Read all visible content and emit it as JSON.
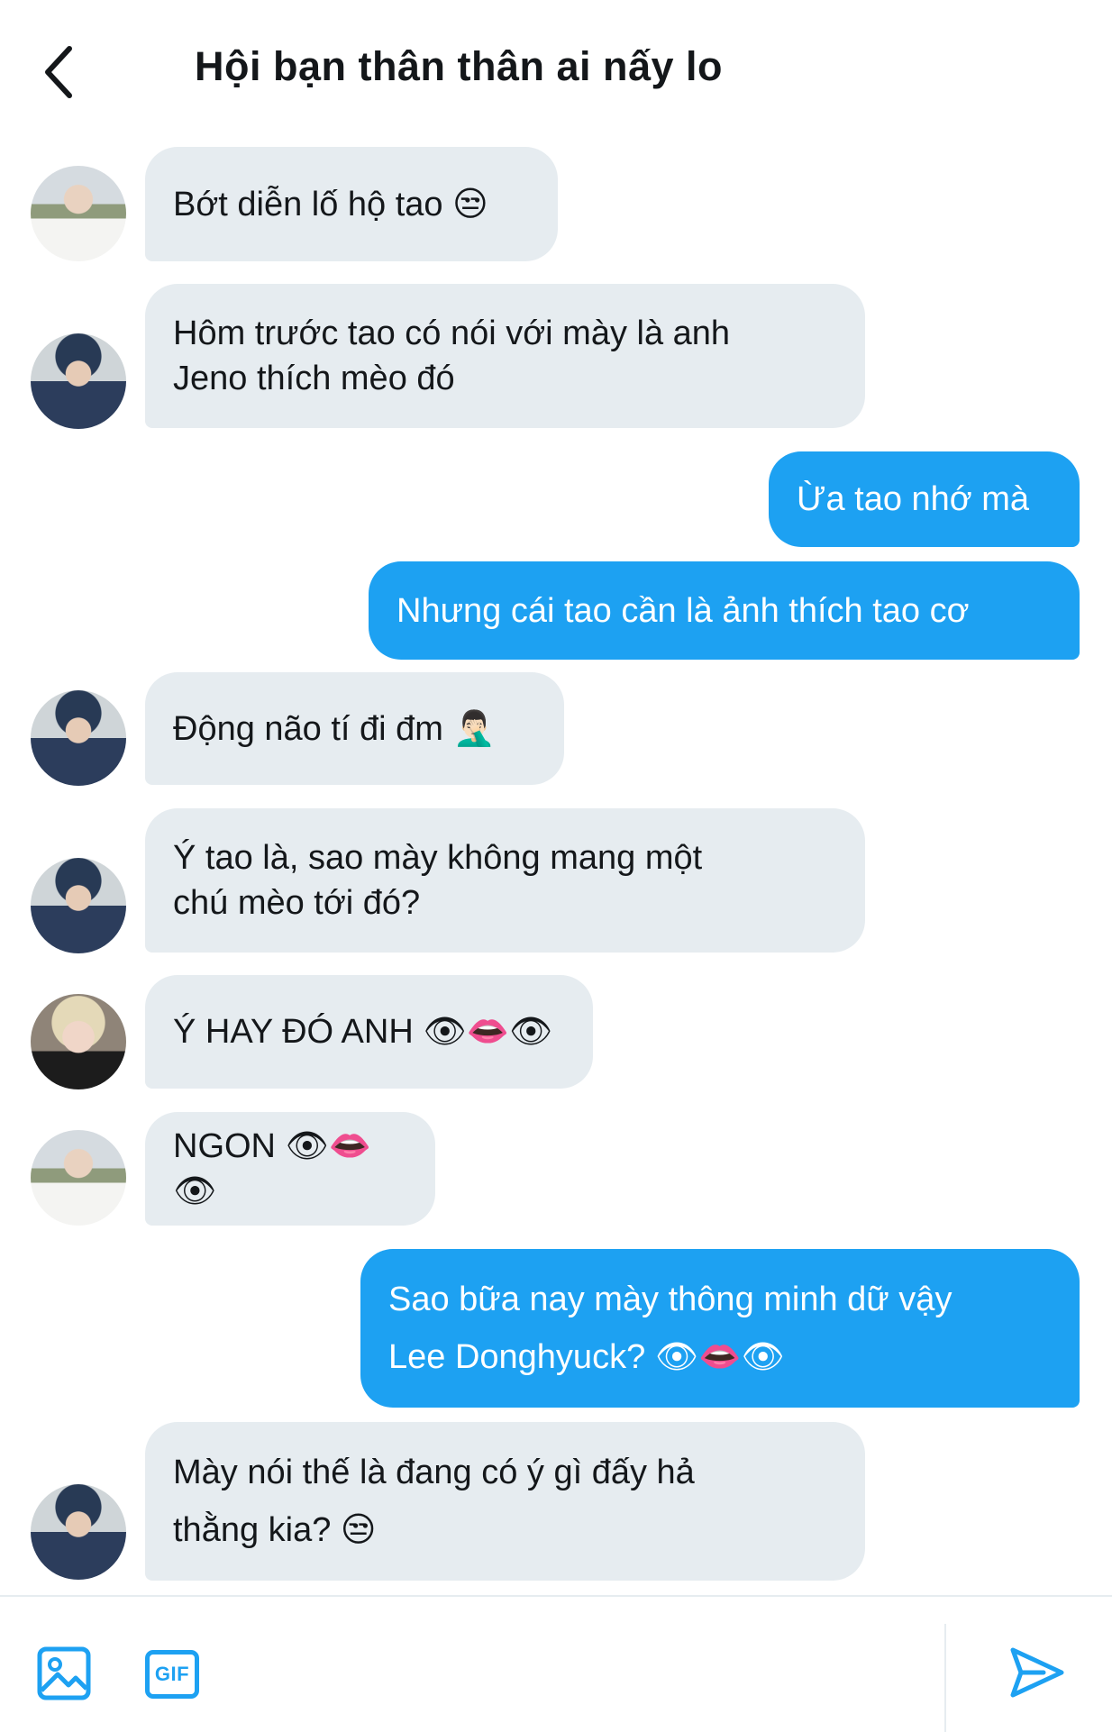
{
  "header": {
    "title": "Hội bạn thân thân ai nấy lo",
    "back_icon": "chevron-left-icon"
  },
  "messages": [
    {
      "side": "in",
      "avatar": "a",
      "text": "Bớt diễn lố hộ tao 😒"
    },
    {
      "side": "in",
      "avatar": "b",
      "text": "Hôm trước tao có nói với mày là anh\nJeno thích mèo đó"
    },
    {
      "side": "out",
      "text": "Ừa tao nhớ mà"
    },
    {
      "side": "out",
      "text": "Nhưng cái tao cần là ảnh thích tao cơ"
    },
    {
      "side": "in",
      "avatar": "b",
      "text": "Động não tí đi đm 🤦🏻‍♂️"
    },
    {
      "side": "in",
      "avatar": "b",
      "text": "Ý tao là, sao mày không mang một\nchú mèo tới đó?"
    },
    {
      "side": "in",
      "avatar": "c",
      "text": "Ý HAY ĐÓ ANH 👁👄👁"
    },
    {
      "side": "in",
      "avatar": "a",
      "text": "NGON 👁👄👁"
    },
    {
      "side": "out",
      "text": "Sao bữa nay mày thông minh dữ vậy\nLee Donghyuck? 👁👄👁"
    },
    {
      "side": "in",
      "avatar": "b",
      "text": "Mày nói thế là đang có ý gì đấy hả\nthằng kia? 😒"
    }
  ],
  "composer": {
    "image_icon": "image-icon",
    "gif_label": "GIF",
    "send_icon": "send-icon"
  },
  "colors": {
    "accent": "#1da1f2",
    "incoming_bubble": "#e6ecf0"
  }
}
